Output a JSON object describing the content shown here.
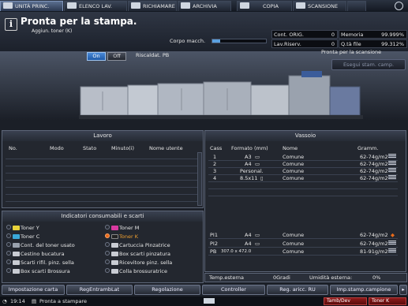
{
  "tabs": [
    {
      "label": "UNITÀ PRINC.",
      "icon": "home-icon"
    },
    {
      "label": "ELENCO LAV.",
      "icon": "list-icon"
    },
    {
      "label": "RICHIAMARE",
      "icon": "recall-icon"
    },
    {
      "label": "ARCHIVIA",
      "icon": "archive-icon"
    },
    {
      "label": "COPIA",
      "icon": "copy-icon"
    },
    {
      "label": "SCANSIONE",
      "icon": "scan-icon"
    }
  ],
  "header": {
    "title": "Pronta per la stampa.",
    "subtitle": "Aggiun. toner (K)",
    "corpo_label": "Corpo macch.",
    "corpo_level": 0.15
  },
  "counters": {
    "cont_orig_label": "Cont. ORIG.",
    "cont_orig_value": "0",
    "memoria_label": "Memoria",
    "memoria_value": "99.999%",
    "lav_riserv_label": "Lav.Riserv.",
    "lav_riserv_value": "0",
    "qta_file_label": "Q.tà file",
    "qta_file_value": "99.312%"
  },
  "machine": {
    "on_label": "On",
    "off_label": "Off",
    "riscaldat_label": "Riscaldat. PB",
    "scan_status": "Pronta per la scansione",
    "esegui_label": "Esegui stam. camp."
  },
  "lavoro": {
    "title": "Lavoro",
    "columns": [
      "No.",
      "Modo",
      "Stato",
      "Minuto(i)",
      "Nome utente"
    ]
  },
  "consumabili": {
    "title": "Indicatori consumabili e scarti",
    "left": [
      {
        "label": "Toner Y",
        "icon": "toner-icon",
        "warn": false
      },
      {
        "label": "Toner C",
        "icon": "toner-icon",
        "warn": false
      },
      {
        "label": "Cont. del toner usato",
        "icon": "waste-toner-icon",
        "warn": false
      },
      {
        "label": "Cestino bucatura",
        "icon": "punch-waste-icon",
        "warn": false
      },
      {
        "label": "Scarti rifil. pinz. sella",
        "icon": "trim-waste-icon",
        "warn": false
      },
      {
        "label": "Box scarti Brossura",
        "icon": "perfect-bind-waste-icon",
        "warn": false
      }
    ],
    "right": [
      {
        "label": "Toner M",
        "icon": "toner-icon",
        "warn": false
      },
      {
        "label": "Toner K",
        "icon": "toner-icon",
        "warn": true
      },
      {
        "label": "Cartuccia Pinzatrice",
        "icon": "staple-cartridge-icon",
        "warn": false
      },
      {
        "label": "Box scarti pinzatura",
        "icon": "staple-waste-icon",
        "warn": false
      },
      {
        "label": "Ricevitore pinz. sella",
        "icon": "saddle-staple-icon",
        "warn": false
      },
      {
        "label": "Colla brossuratrice",
        "icon": "glue-icon",
        "warn": false
      }
    ]
  },
  "vassoio": {
    "title": "Vassoio",
    "columns": [
      "Cass",
      "Formato (mm)",
      "Nome",
      "Gramm."
    ],
    "rows": [
      {
        "cass": "1",
        "formato": "A3",
        "orient": "landscape",
        "nome": "Comune",
        "gramm": "62-74g/m2"
      },
      {
        "cass": "2",
        "formato": "A4",
        "orient": "landscape",
        "nome": "Comune",
        "gramm": "62-74g/m2"
      },
      {
        "cass": "3",
        "formato": "Personal.",
        "orient": "",
        "nome": "Comune",
        "gramm": "62-74g/m2"
      },
      {
        "cass": "4",
        "formato": "8.5x11",
        "orient": "portrait",
        "nome": "Comune",
        "gramm": "62-74g/m2"
      }
    ],
    "pi_rows": [
      {
        "cass": "PI1",
        "formato": "A4",
        "orient": "landscape",
        "nome": "Comune",
        "gramm": "62-74g/m2"
      },
      {
        "cass": "PI2",
        "formato": "A4",
        "orient": "landscape",
        "nome": "Comune",
        "gramm": "62-74g/m2"
      },
      {
        "cass": "PB",
        "formato": "307.0 x 472.0",
        "orient": "",
        "nome": "Comune",
        "gramm": "81-91g/m2"
      }
    ]
  },
  "status": {
    "temp_label": "Temp.esterna",
    "temp_value": "0Gradi",
    "umid_label": "Umidità esterna:",
    "umid_value": "0%"
  },
  "bottom_buttons": [
    "Impostazione carta",
    "RegEntrambLat",
    "Regolazione",
    "Controller",
    "Reg. aricc. RU",
    "Imp.stamp.campione"
  ],
  "footer": {
    "time": "19:14",
    "status": "Pronta a stampare",
    "tamb_label": "Tamb/Dev",
    "toner_label": "Toner K"
  },
  "colors": {
    "accent": "#4a8ad8",
    "warning": "#e86a1a",
    "alert": "#8e1a1a"
  }
}
